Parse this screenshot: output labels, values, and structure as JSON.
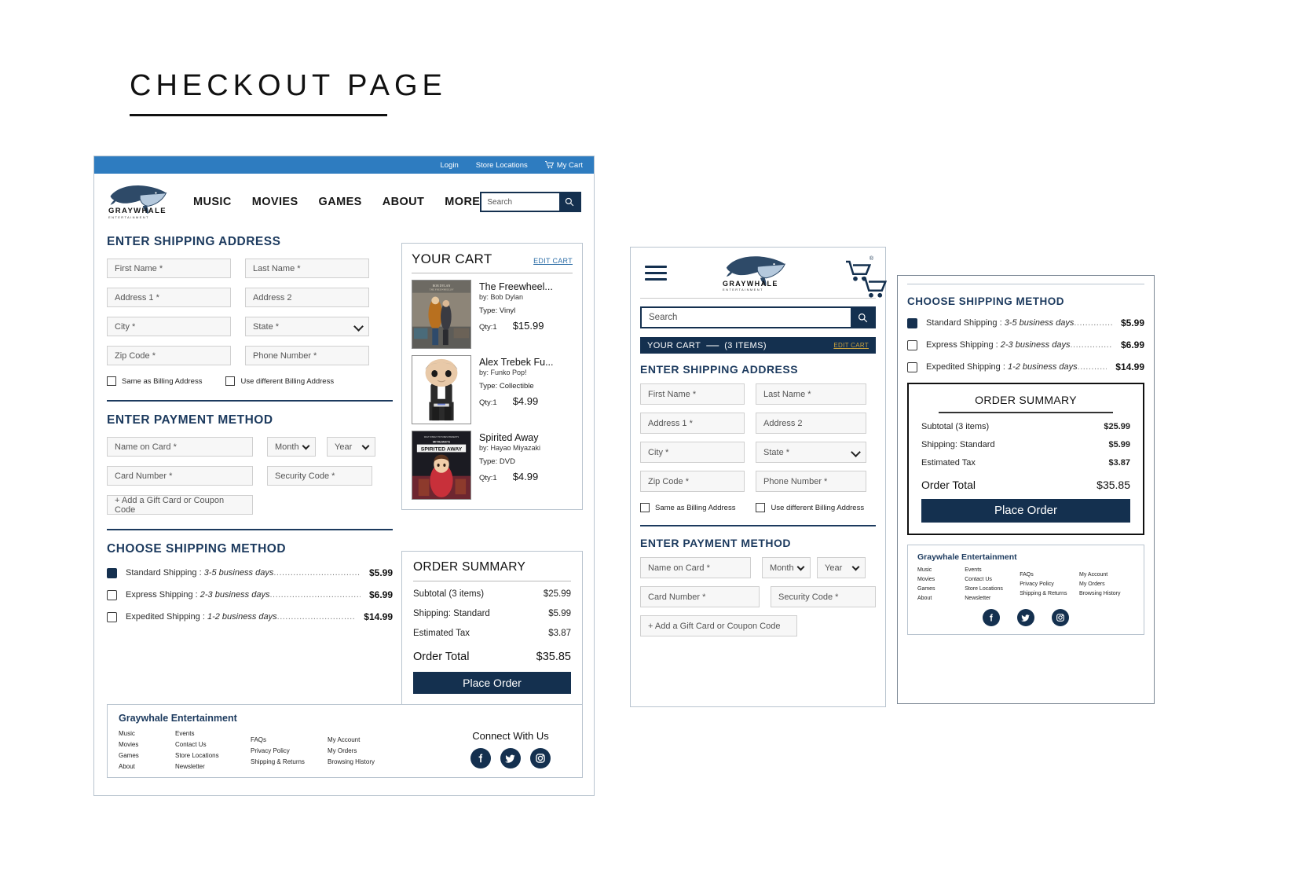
{
  "page": {
    "title": "CHECKOUT PAGE"
  },
  "brand": {
    "name": "GRAYWHALE",
    "tagline": "ENTERTAINMENT",
    "footer_name": "Graywhale Entertainment"
  },
  "colors": {
    "topbar_blue": "#2e7cc0",
    "navy": "#14304f",
    "heading_navy": "#1c3a5e",
    "edit_link_blue": "#2f6fa8",
    "edit_link_gold": "#c9a23f"
  },
  "desktop": {
    "topbar": {
      "login": "Login",
      "store_locations": "Store Locations",
      "cart": "My Cart",
      "cart_icon": "shopping-cart-icon"
    },
    "nav": {
      "items": [
        "MUSIC",
        "MOVIES",
        "GAMES",
        "ABOUT",
        "MORE"
      ]
    },
    "search": {
      "placeholder": "Search",
      "value": "Search",
      "icon": "search-icon"
    },
    "shipping_section": {
      "heading": "ENTER SHIPPING ADDRESS",
      "fields": [
        {
          "label": "First Name *",
          "type": "text"
        },
        {
          "label": "Last Name *",
          "type": "text"
        },
        {
          "label": "Address 1 *",
          "type": "text"
        },
        {
          "label": "Address 2",
          "type": "text"
        },
        {
          "label": "City *",
          "type": "text"
        },
        {
          "label": "State *",
          "type": "select"
        },
        {
          "label": "Zip Code *",
          "type": "text"
        },
        {
          "label": "Phone Number *",
          "type": "text"
        }
      ],
      "checkboxes": [
        {
          "label": "Same as Billing Address",
          "checked": false
        },
        {
          "label": "Use different Billing Address",
          "checked": false
        }
      ]
    },
    "payment_section": {
      "heading": "ENTER PAYMENT METHOD",
      "name_on_card": "Name on Card *",
      "month": "Month",
      "year": "Year",
      "card_number": "Card Number *",
      "security_code": "Security Code *",
      "gift_card": "+ Add a Gift Card or Coupon Code"
    },
    "shipping_method": {
      "heading": "CHOOSE SHIPPING METHOD",
      "options": [
        {
          "name": "Standard Shipping : ",
          "days": "3-5 business days",
          "price": "$5.99",
          "selected": true
        },
        {
          "name": "Express Shipping : ",
          "days": "2-3 business days",
          "price": "$6.99",
          "selected": false
        },
        {
          "name": "Expedited Shipping : ",
          "days": "1-2 business days",
          "price": "$14.99",
          "selected": false
        }
      ]
    },
    "cart": {
      "title": "YOUR CART",
      "edit_label": "EDIT CART",
      "items": [
        {
          "title": "The Freewheel...",
          "by": "by: Bob Dylan",
          "type": "Type: Vinyl",
          "qty": "Qty:1",
          "price": "$15.99",
          "thumb": "album-cover-freewheelin"
        },
        {
          "title": "Alex Trebek Fu...",
          "by": "by: Funko Pop!",
          "type": "Type: Collectible",
          "qty": "Qty:1",
          "price": "$4.99",
          "thumb": "funko-pop-figure"
        },
        {
          "title": "Spirited Away",
          "by": "by: Hayao Miyazaki",
          "type": "Type: DVD",
          "qty": "Qty:1",
          "price": "$4.99",
          "thumb": "dvd-cover-spirited-away"
        }
      ]
    },
    "order_summary": {
      "title": "ORDER SUMMARY",
      "rows": [
        {
          "label": "Subtotal (3 items)",
          "value": "$25.99"
        },
        {
          "label": "Shipping: Standard",
          "value": "$5.99"
        },
        {
          "label": "Estimated Tax",
          "value": "$3.87"
        }
      ],
      "total_label": "Order Total",
      "total_value": "$35.85",
      "place_order": "Place Order"
    },
    "footer": {
      "brand": "Graywhale Entertainment",
      "col1": [
        "Music",
        "Movies",
        "Games",
        "About"
      ],
      "col2": [
        "Events",
        "Contact Us",
        "Store Locations",
        "Newsletter"
      ],
      "col3": [
        "FAQs",
        "Privacy Policy",
        "Shipping & Returns"
      ],
      "col4": [
        "My Account",
        "My Orders",
        "Browsing History"
      ],
      "connect": "Connect With Us",
      "socials": [
        "facebook-icon",
        "twitter-icon",
        "instagram-icon"
      ]
    }
  },
  "mobile": {
    "menu_icon": "hamburger-menu-icon",
    "cart_icon": "shopping-cart-icon",
    "search": {
      "placeholder": "Search",
      "value": "Search",
      "icon": "search-icon"
    },
    "cart_bar": {
      "label": "YOUR CART",
      "dash": "—",
      "items": "(3 ITEMS)",
      "edit": "EDIT CART"
    },
    "shipping_section": {
      "heading": "ENTER SHIPPING ADDRESS",
      "fields": [
        {
          "label": "First Name *",
          "type": "text"
        },
        {
          "label": "Last Name *",
          "type": "text"
        },
        {
          "label": "Address 1 *",
          "type": "text"
        },
        {
          "label": "Address 2",
          "type": "text"
        },
        {
          "label": "City *",
          "type": "text"
        },
        {
          "label": "State *",
          "type": "select"
        },
        {
          "label": "Zip Code *",
          "type": "text"
        },
        {
          "label": "Phone Number *",
          "type": "text"
        }
      ],
      "checkboxes": [
        {
          "label": "Same as Billing Address",
          "checked": false
        },
        {
          "label": "Use different Billing Address",
          "checked": false
        }
      ]
    },
    "payment_section": {
      "heading": "ENTER PAYMENT METHOD",
      "name_on_card": "Name on Card *",
      "month": "Month",
      "year": "Year",
      "card_number": "Card Number *",
      "security_code": "Security Code *",
      "gift_card": "+ Add a Gift Card or Coupon Code"
    }
  },
  "tablet": {
    "cart_icon": "shopping-cart-icon",
    "shipping_method": {
      "heading": "CHOOSE SHIPPING METHOD",
      "options": [
        {
          "name": "Standard Shipping : ",
          "days": "3-5 business days",
          "price": "$5.99",
          "selected": true
        },
        {
          "name": "Express Shipping : ",
          "days": "2-3 business days",
          "price": "$6.99",
          "selected": false
        },
        {
          "name": "Expedited Shipping : ",
          "days": "1-2 business days",
          "price": "$14.99",
          "selected": false
        }
      ]
    },
    "order_summary": {
      "title": "ORDER SUMMARY",
      "rows": [
        {
          "label": "Subtotal (3 items)",
          "value": "$25.99"
        },
        {
          "label": "Shipping: Standard",
          "value": "$5.99"
        },
        {
          "label": "Estimated Tax",
          "value": "$3.87"
        }
      ],
      "total_label": "Order Total",
      "total_value": "$35.85",
      "place_order": "Place Order"
    },
    "footer": {
      "brand": "Graywhale Entertainment",
      "col1": [
        "Music",
        "Movies",
        "Games",
        "About"
      ],
      "col2": [
        "Events",
        "Contact Us",
        "Store Locations",
        "Newsletter"
      ],
      "col3": [
        "FAQs",
        "Privacy Policy",
        "Shipping & Returns"
      ],
      "col4": [
        "My Account",
        "My Orders",
        "Browsing History"
      ],
      "socials": [
        "facebook-icon",
        "twitter-icon",
        "instagram-icon"
      ]
    }
  }
}
